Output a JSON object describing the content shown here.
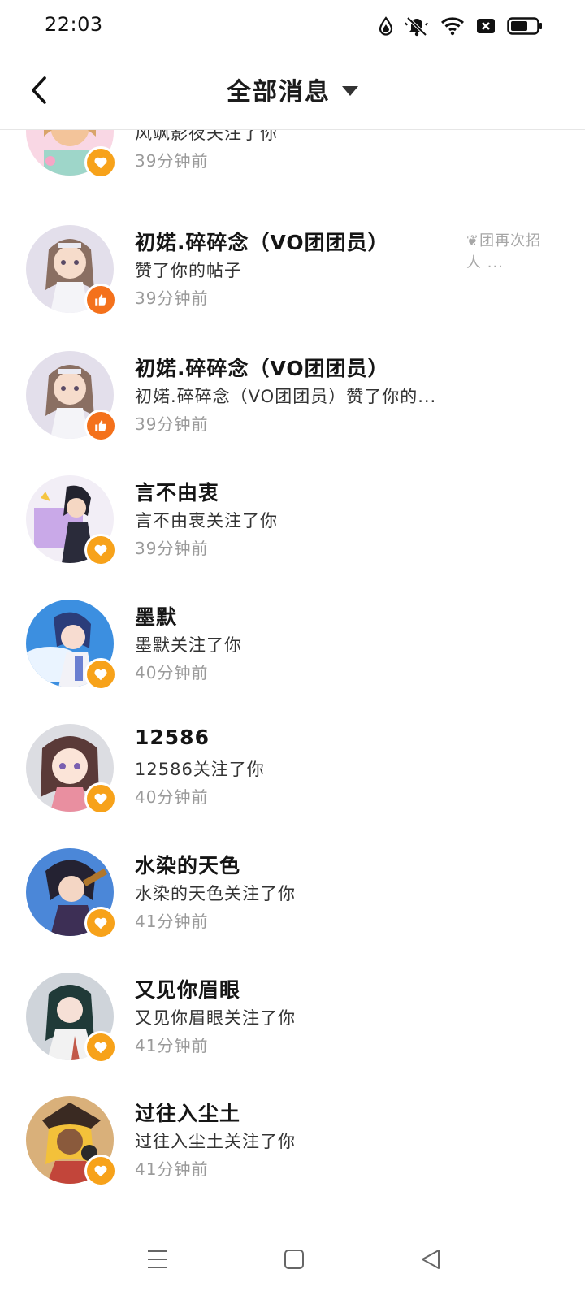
{
  "status_bar": {
    "time": "22:03",
    "icons": [
      "water-drop-icon",
      "silent-bell-icon",
      "wifi-icon",
      "sim-x-icon",
      "battery-icon"
    ]
  },
  "header": {
    "back_icon": "chevron-left-icon",
    "title": "全部消息",
    "dropdown_icon": "caret-down-icon"
  },
  "messages": [
    {
      "name": "",
      "desc": "风飒影夜关注了你",
      "time": "39分钟前",
      "badge": "follow",
      "preview": ""
    },
    {
      "name": "初婼.碎碎念（VO团团员）",
      "desc": "赞了你的帖子",
      "time": "39分钟前",
      "badge": "like",
      "preview": "❦团再次招人 ..."
    },
    {
      "name": "初婼.碎碎念（VO团团员）",
      "desc": "初婼.碎碎念（VO团团员）赞了你的...",
      "time": "39分钟前",
      "badge": "like",
      "preview": ""
    },
    {
      "name": "言不由衷",
      "desc": "言不由衷关注了你",
      "time": "39分钟前",
      "badge": "follow",
      "preview": ""
    },
    {
      "name": "墨默",
      "desc": "墨默关注了你",
      "time": "40分钟前",
      "badge": "follow",
      "preview": ""
    },
    {
      "name": "12586",
      "desc": "12586关注了你",
      "time": "40分钟前",
      "badge": "follow",
      "preview": ""
    },
    {
      "name": "水染的天色",
      "desc": "水染的天色关注了你",
      "time": "41分钟前",
      "badge": "follow",
      "preview": ""
    },
    {
      "name": "又见你眉眼",
      "desc": "又见你眉眼关注了你",
      "time": "41分钟前",
      "badge": "follow",
      "preview": ""
    },
    {
      "name": "过往入尘土",
      "desc": "过往入尘土关注了你",
      "time": "41分钟前",
      "badge": "follow",
      "preview": ""
    }
  ],
  "colors": {
    "follow_badge": "#f7a21a",
    "like_badge": "#f4711b",
    "divider": "#e6e6e6"
  },
  "nav": {
    "icons": [
      "menu-icon",
      "home-square-icon",
      "back-triangle-icon"
    ]
  }
}
